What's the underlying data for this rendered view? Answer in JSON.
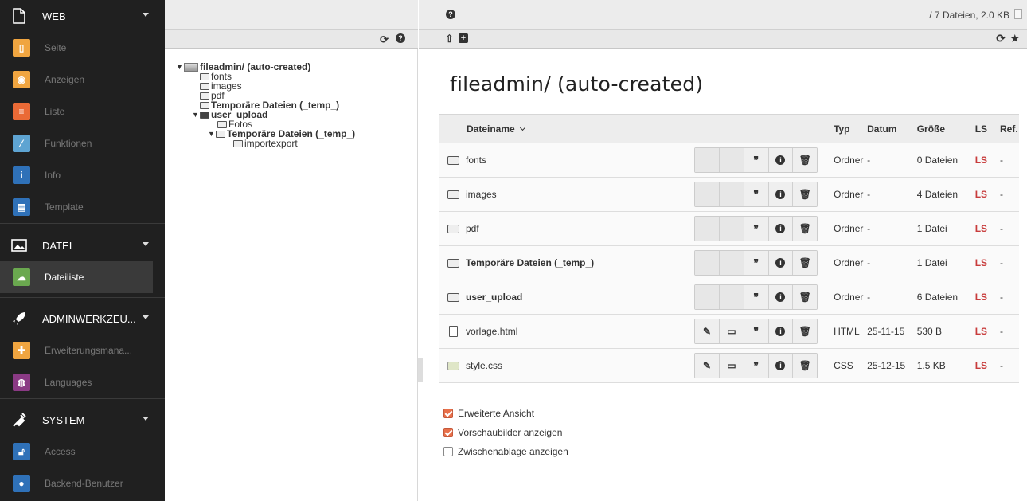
{
  "menu": {
    "groups": [
      {
        "label": "WEB",
        "icon": "page-outline-icon",
        "items": [
          {
            "label": "Seite",
            "icon": "page-icon",
            "color": "#f0a540"
          },
          {
            "label": "Anzeigen",
            "icon": "eye-icon",
            "color": "#f0a540"
          },
          {
            "label": "Liste",
            "icon": "list-icon",
            "color": "#ea6a36"
          },
          {
            "label": "Funktionen",
            "icon": "wand-icon",
            "color": "#5ea4d2"
          },
          {
            "label": "Info",
            "icon": "info-icon",
            "color": "#2f71b8"
          },
          {
            "label": "Template",
            "icon": "template-icon",
            "color": "#2f71b8"
          }
        ]
      },
      {
        "label": "DATEI",
        "icon": "image-icon",
        "items": [
          {
            "label": "Dateiliste",
            "icon": "cloud-icon",
            "color": "#6aa84f",
            "active": true
          }
        ]
      },
      {
        "label": "ADMINWERKZEU...",
        "icon": "rocket-icon",
        "items": [
          {
            "label": "Erweiterungsmana...",
            "icon": "puzzle-icon",
            "color": "#f0a540"
          },
          {
            "label": "Languages",
            "icon": "globe-icon",
            "color": "#8a3a84"
          }
        ]
      },
      {
        "label": "SYSTEM",
        "icon": "plug-icon",
        "items": [
          {
            "label": "Access",
            "icon": "lock-icon",
            "color": "#2f71b8"
          },
          {
            "label": "Backend-Benutzer",
            "icon": "user-icon",
            "color": "#2f71b8"
          }
        ]
      }
    ]
  },
  "docheader": {
    "file_count": "/ 7 Dateien, 2.0 KB"
  },
  "tree": {
    "root": "fileadmin/ (auto-created)",
    "nodes": [
      "fonts",
      "images",
      "pdf",
      "Temporäre Dateien (_temp_)",
      "user_upload",
      "Fotos",
      "Temporäre Dateien (_temp_)",
      "importexport"
    ]
  },
  "main": {
    "title": "fileadmin/ (auto-created)",
    "columns": {
      "name": "Dateiname",
      "typ": "Typ",
      "datum": "Datum",
      "groesse": "Größe",
      "ls": "LS",
      "ref": "Ref."
    },
    "rows": [
      {
        "name": "fonts",
        "bold": false,
        "kind": "folder",
        "typ": "Ordner",
        "datum": "-",
        "groesse": "0 Dateien",
        "ls": "LS",
        "ref": "-"
      },
      {
        "name": "images",
        "bold": false,
        "kind": "folder",
        "typ": "Ordner",
        "datum": "-",
        "groesse": "4 Dateien",
        "ls": "LS",
        "ref": "-"
      },
      {
        "name": "pdf",
        "bold": false,
        "kind": "folder",
        "typ": "Ordner",
        "datum": "-",
        "groesse": "1 Datei",
        "ls": "LS",
        "ref": "-"
      },
      {
        "name": "Temporäre Dateien (_temp_)",
        "bold": true,
        "kind": "folder",
        "typ": "Ordner",
        "datum": "-",
        "groesse": "1 Datei",
        "ls": "LS",
        "ref": "-"
      },
      {
        "name": "user_upload",
        "bold": true,
        "kind": "folder",
        "typ": "Ordner",
        "datum": "-",
        "groesse": "6 Dateien",
        "ls": "LS",
        "ref": "-"
      },
      {
        "name": "vorlage.html",
        "bold": false,
        "kind": "doc",
        "typ": "HTML",
        "datum": "25-11-15",
        "groesse": "530 B",
        "ls": "LS",
        "ref": "-"
      },
      {
        "name": "style.css",
        "bold": false,
        "kind": "img",
        "typ": "CSS",
        "datum": "25-12-15",
        "groesse": "1.5 KB",
        "ls": "LS",
        "ref": "-"
      }
    ],
    "options": [
      {
        "label": "Erweiterte Ansicht",
        "checked": true
      },
      {
        "label": "Vorschaubilder anzeigen",
        "checked": true
      },
      {
        "label": "Zwischenablage anzeigen",
        "checked": false
      }
    ]
  }
}
